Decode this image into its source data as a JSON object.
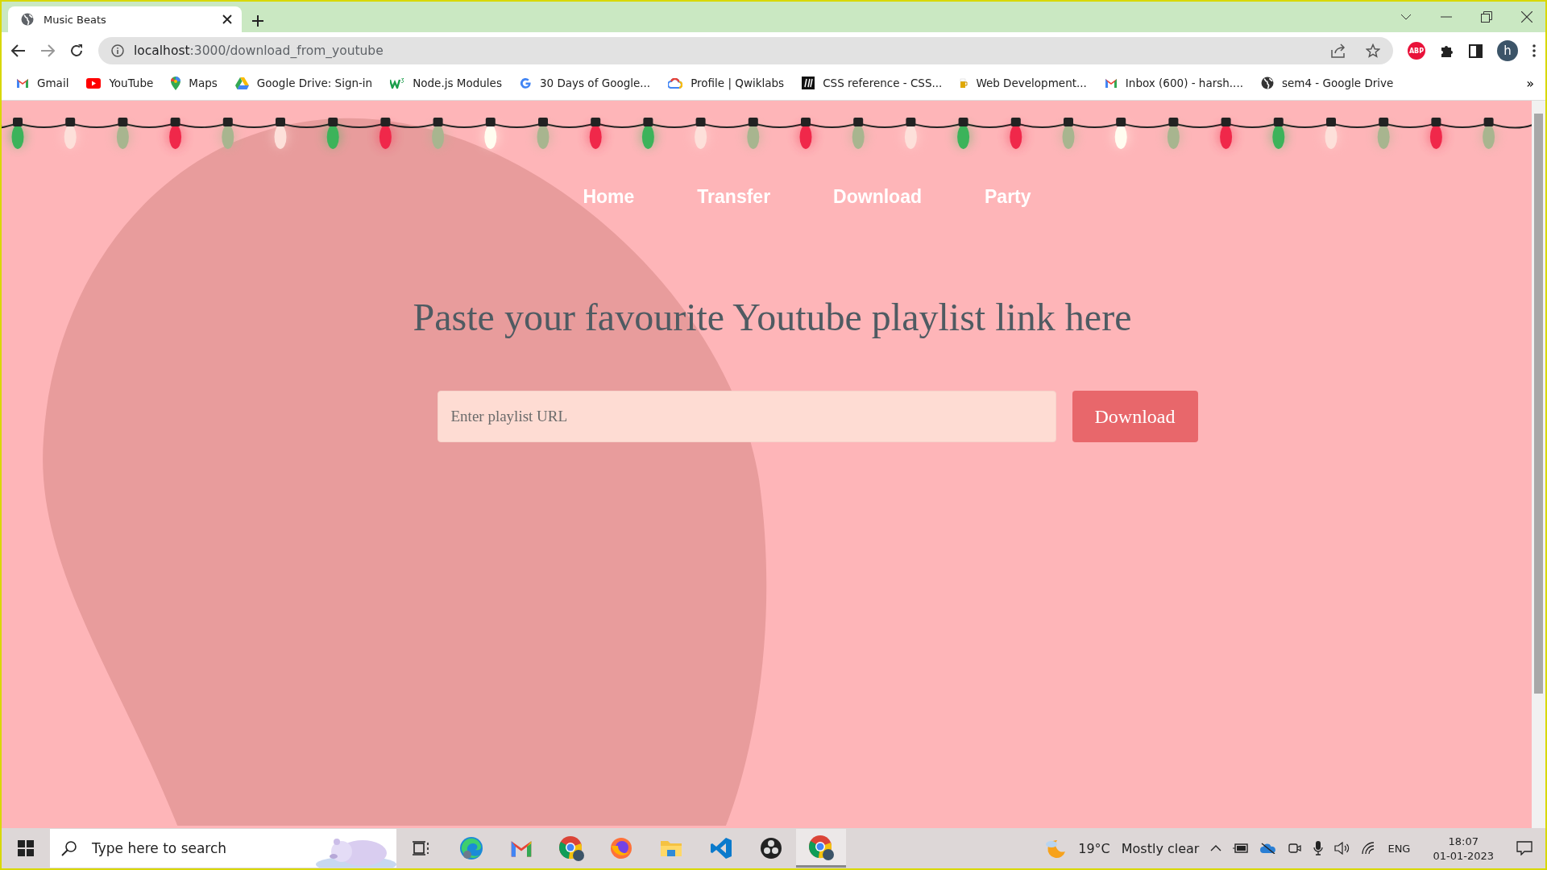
{
  "browser": {
    "tab_title": "Music Beats",
    "url_host": "localhost",
    "url_path": ":3000/download_from_youtube",
    "adblock_label": "ABP",
    "profile_initial": "h",
    "overflow": "»",
    "bookmarks": [
      {
        "kind": "gmail",
        "label": "Gmail"
      },
      {
        "kind": "youtube",
        "label": "YouTube"
      },
      {
        "kind": "maps",
        "label": "Maps"
      },
      {
        "kind": "drive",
        "label": "Google Drive: Sign-in"
      },
      {
        "kind": "w3",
        "label": "Node.js Modules"
      },
      {
        "kind": "google",
        "label": "30 Days of Google..."
      },
      {
        "kind": "cloud",
        "label": "Profile | Qwiklabs"
      },
      {
        "kind": "css",
        "label": "CSS reference - CSS..."
      },
      {
        "kind": "beer",
        "label": "Web Development..."
      },
      {
        "kind": "gmail",
        "label": "Inbox (600) - harsh...."
      },
      {
        "kind": "globe",
        "label": "sem4 - Google Drive"
      }
    ]
  },
  "page": {
    "lights": [
      {
        "color": "#3cb35a"
      },
      {
        "color": "#fde0da"
      },
      {
        "color": "#a8b58f"
      },
      {
        "color": "#f0284a"
      },
      {
        "color": "#a8b58f"
      },
      {
        "color": "#fde0da"
      },
      {
        "color": "#3cb35a"
      },
      {
        "color": "#f0284a"
      },
      {
        "color": "#a8b58f"
      },
      {
        "color": "#fffdf0"
      },
      {
        "color": "#a8b58f"
      },
      {
        "color": "#f0284a"
      },
      {
        "color": "#3cb35a"
      },
      {
        "color": "#fde0da"
      },
      {
        "color": "#a8b58f"
      },
      {
        "color": "#f0284a"
      },
      {
        "color": "#a8b58f"
      },
      {
        "color": "#fde0da"
      },
      {
        "color": "#3cb35a"
      },
      {
        "color": "#f0284a"
      },
      {
        "color": "#a8b58f"
      },
      {
        "color": "#fffdf0"
      },
      {
        "color": "#a8b58f"
      },
      {
        "color": "#f0284a"
      },
      {
        "color": "#3cb35a"
      },
      {
        "color": "#fde0da"
      },
      {
        "color": "#a8b58f"
      },
      {
        "color": "#f0284a"
      },
      {
        "color": "#a8b58f"
      }
    ],
    "nav": [
      {
        "label": "Home"
      },
      {
        "label": "Transfer"
      },
      {
        "label": "Download"
      },
      {
        "label": "Party"
      }
    ],
    "heading": "Paste your favourite Youtube playlist link here",
    "url_field": {
      "placeholder": "Enter playlist URL"
    },
    "download_button": "Download"
  },
  "taskbar": {
    "search_placeholder": "Type here to search",
    "apps": [
      {
        "kind": "taskview",
        "selected": false
      },
      {
        "kind": "edge",
        "selected": false
      },
      {
        "kind": "gmail",
        "selected": false
      },
      {
        "kind": "chrome",
        "selected": false
      },
      {
        "kind": "firefox",
        "selected": false
      },
      {
        "kind": "files",
        "selected": false
      },
      {
        "kind": "vscode",
        "selected": false
      },
      {
        "kind": "obs",
        "selected": false
      },
      {
        "kind": "chrome",
        "selected": true
      }
    ],
    "weather_temp": "19°C",
    "weather_text": "Mostly clear",
    "language": "ENG",
    "time": "18:07",
    "date": "01-01-2023"
  }
}
